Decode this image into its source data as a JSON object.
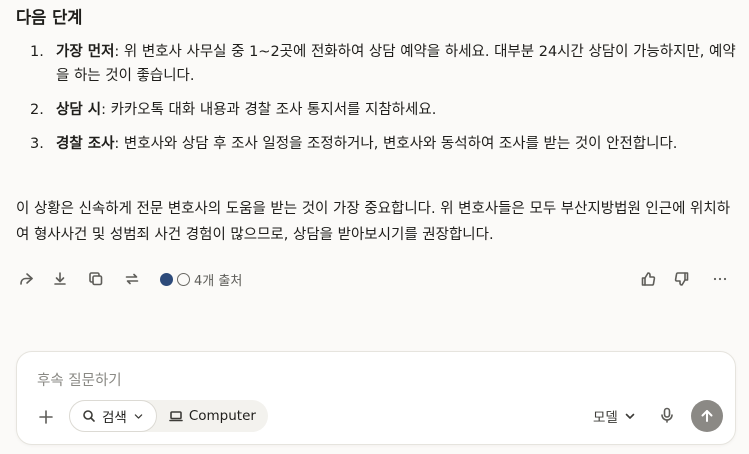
{
  "answer": {
    "heading": "다음 단계",
    "steps": [
      {
        "num": "1.",
        "bold": "가장 먼저",
        "text": ": 위 변호사 사무실 중 1~2곳에 전화하여 상담 예약을 하세요. 대부분 24시간 상담이 가능하지만, 예약을 하는 것이 좋습니다."
      },
      {
        "num": "2.",
        "bold": "상담 시",
        "text": ": 카카오톡 대화 내용과 경찰 조사 통지서를 지참하세요."
      },
      {
        "num": "3.",
        "bold": "경찰 조사",
        "text": ": 변호사와 상담 후 조사 일정을 조정하거나, 변호사와 동석하여 조사를 받는 것이 안전합니다."
      }
    ],
    "paragraph": "이 상황은 신속하게 전문 변호사의 도움을 받는 것이 가장 중요합니다. 위 변호사들은 모두 부산지방법원 인근에 위치하여 형사사건 및 성범죄 사건 경험이 많으므로, 상담을 받아보시기를 권장합니다."
  },
  "actions": {
    "sources_label": "4개 출처",
    "icons": [
      "share-icon",
      "download-icon",
      "copy-icon",
      "retry-icon",
      "thumbs-up-icon",
      "thumbs-down-icon",
      "more-icon"
    ]
  },
  "composer": {
    "placeholder": "후속 질문하기",
    "search_label": "검색",
    "computer_label": "Computer",
    "model_label": "모델"
  },
  "colors": {
    "background": "#fbfaf8",
    "send_button": "#8b8985",
    "text": "#1f1e1b"
  }
}
